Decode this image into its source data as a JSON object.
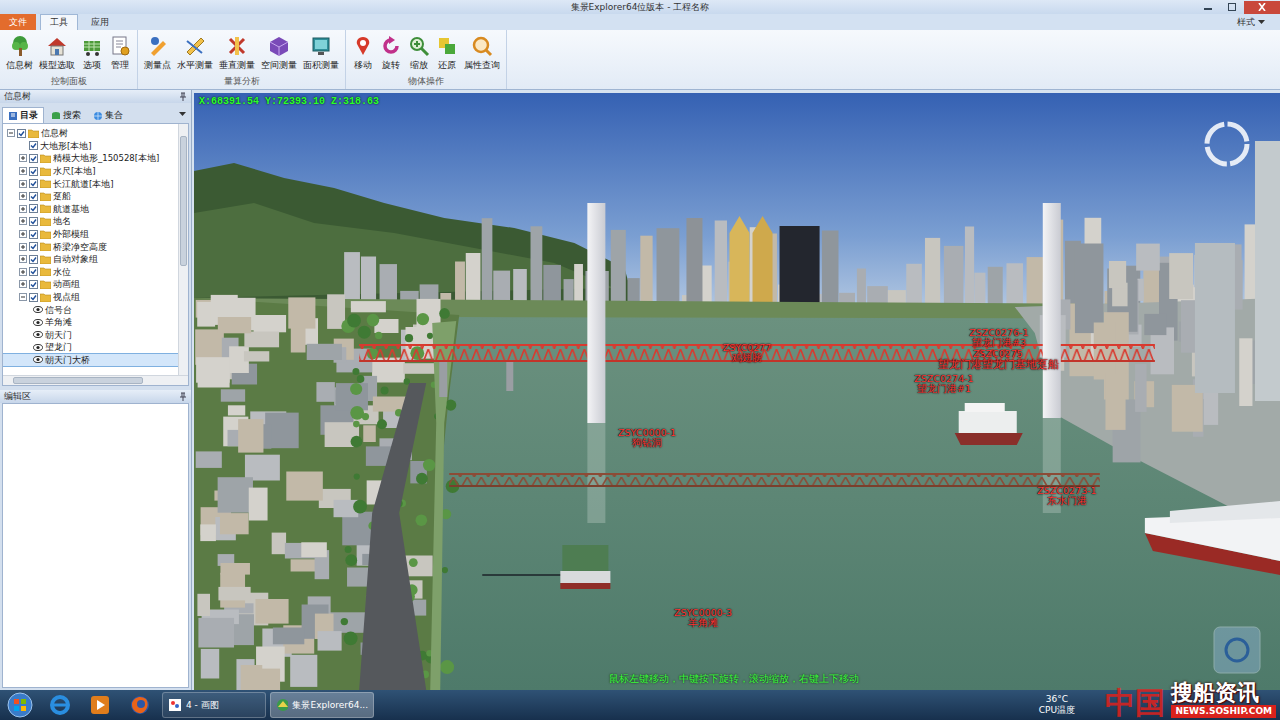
{
  "window": {
    "title": "集景Explorer64位版本 - 工程名称"
  },
  "menu_tabs": [
    {
      "label": "文件",
      "selected": false
    },
    {
      "label": "工具",
      "selected": true
    },
    {
      "label": "应用",
      "selected": false
    }
  ],
  "style_menu": "样式",
  "ribbon": [
    {
      "label": "控制面板",
      "buttons": [
        "信息树",
        "模型选取",
        "选项",
        "管理"
      ]
    },
    {
      "label": "量算分析",
      "buttons": [
        "测量点",
        "水平测量",
        "垂直测量",
        "空间测量",
        "面积测量"
      ]
    },
    {
      "label": "物体操作",
      "buttons": [
        "移动",
        "旋转",
        "缩放",
        "还原",
        "属性查询"
      ]
    }
  ],
  "info_tree": {
    "title": "信息树",
    "tabs": [
      {
        "label": "目录",
        "selected": true
      },
      {
        "label": "搜索",
        "selected": false
      },
      {
        "label": "集合",
        "selected": false
      }
    ],
    "root": {
      "label": "信息树",
      "expanded": true,
      "checked": true
    },
    "nodes": [
      {
        "label": "大地形[本地]",
        "kind": "layer",
        "checked": true
      },
      {
        "label": "精模大地形_150528[本地]",
        "kind": "folder",
        "expanded": false,
        "checked": true
      },
      {
        "label": "水尺[本地]",
        "kind": "folder",
        "expanded": false,
        "checked": true
      },
      {
        "label": "长江航道[本地]",
        "kind": "folder",
        "expanded": false,
        "checked": true
      },
      {
        "label": "趸船",
        "kind": "folder",
        "expanded": false,
        "checked": true
      },
      {
        "label": "航道基地",
        "kind": "folder",
        "expanded": false,
        "checked": true
      },
      {
        "label": "地名",
        "kind": "folder",
        "expanded": false,
        "checked": true
      },
      {
        "label": "外部模组",
        "kind": "folder",
        "expanded": false,
        "checked": true
      },
      {
        "label": "桥梁净空高度",
        "kind": "folder",
        "expanded": false,
        "checked": true
      },
      {
        "label": "自动对象组",
        "kind": "folder",
        "expanded": false,
        "checked": true
      },
      {
        "label": "水位",
        "kind": "folder",
        "expanded": false,
        "checked": true
      },
      {
        "label": "动画组",
        "kind": "folder",
        "expanded": false,
        "checked": true
      },
      {
        "label": "视点组",
        "kind": "folder",
        "expanded": true,
        "checked": true,
        "children": [
          {
            "label": "信号台",
            "selected": false
          },
          {
            "label": "羊角滩",
            "selected": false
          },
          {
            "label": "朝天门",
            "selected": false
          },
          {
            "label": "望龙门",
            "selected": false
          },
          {
            "label": "朝天门大桥",
            "selected": true
          }
        ]
      }
    ]
  },
  "edit_panel": {
    "title": "编辑区"
  },
  "viewport": {
    "coords": "X:68391.54 Y:72393.10 Z:318.63",
    "labels": [
      {
        "code": "ZSYC0277",
        "name": "鸡翅膀"
      },
      {
        "code": "ZSZC0276-1",
        "name": "望龙门港#3"
      },
      {
        "code": "ZSZC0275",
        "name": "望龙门港望龙门基地趸船"
      },
      {
        "code": "ZSZC0274-1",
        "name": "望龙门港#1"
      },
      {
        "code": "ZSYC0000-1",
        "name": "狗钻洞"
      },
      {
        "code": "ZSZC0273-1",
        "name": "东水门港"
      },
      {
        "code": "ZSYC0000-3",
        "name": "羊角滩"
      }
    ],
    "hint": "鼠标左键移动，中键按下旋转，滚动缩放，右键上下移动"
  },
  "taskbar": {
    "tasks": [
      {
        "label": "4 - 画图",
        "selected": false
      },
      {
        "label": "集景Explorer64...",
        "selected": true
      }
    ],
    "temperature": "36°C",
    "temperature_label": "CPU温度"
  },
  "watermark": {
    "logo": "中国",
    "name": "搜船资讯",
    "url": "NEWS.SOSHIP.COM"
  }
}
